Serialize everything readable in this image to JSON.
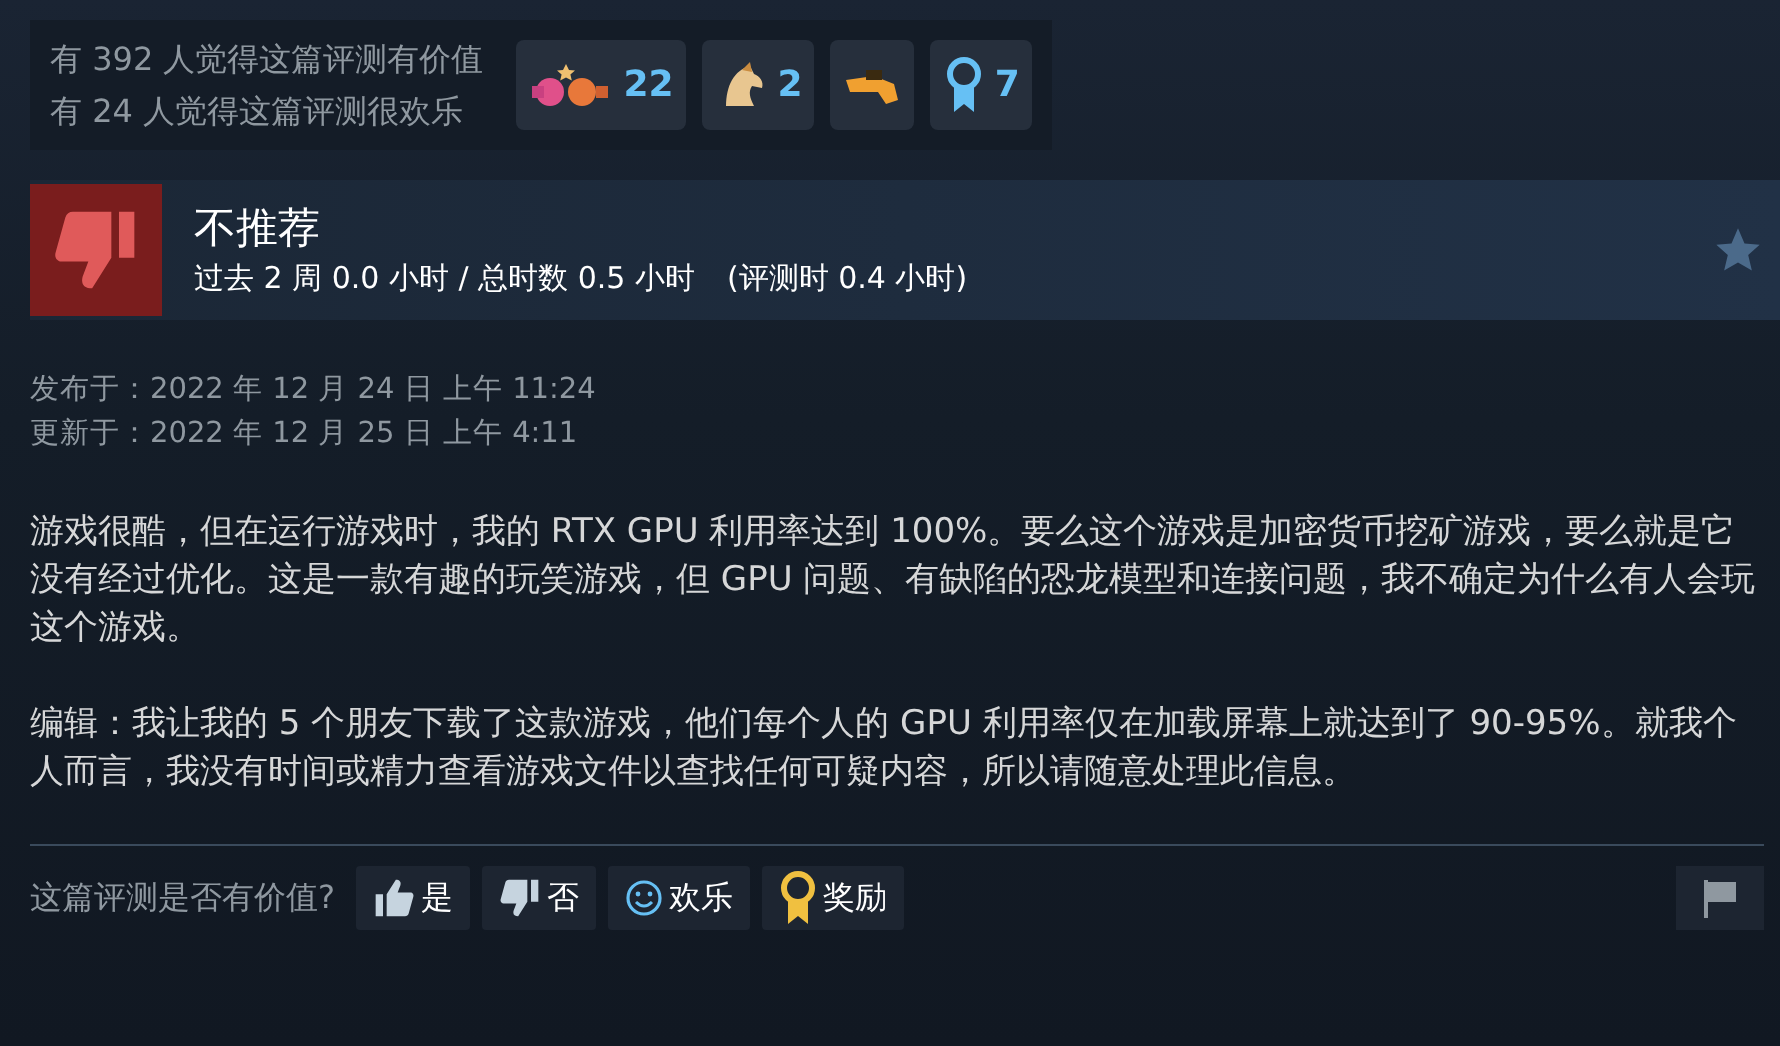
{
  "votes": {
    "helpful": "有 392 人觉得这篇评测有价值",
    "funny": "有 24 人觉得这篇评测很欢乐"
  },
  "awards": [
    {
      "kind": "boxing",
      "count": "22"
    },
    {
      "kind": "horse",
      "count": "2"
    },
    {
      "kind": "hand"
    },
    {
      "kind": "ribbon",
      "count": "7"
    }
  ],
  "review": {
    "recommended": false,
    "title": "不推荐",
    "hours": "过去 2 周 0.0 小时 / 总时数 0.5 小时",
    "hours_at_review": "(评测时 0.4 小时)"
  },
  "dates": [
    "发布于：2022 年 12 月 24 日 上午 11:24",
    "更新于：2022 年 12 月 25 日 上午 4:11"
  ],
  "paragraphs": [
    "游戏很酷，但在运行游戏时，我的 RTX GPU 利用率达到 100%。要么这个游戏是加密货币挖矿游戏，要么就是它没有经过优化。这是一款有趣的玩笑游戏，但 GPU 问题、有缺陷的恐龙模型和连接问题，我不确定为什么有人会玩这个游戏。",
    "编辑：我让我的 5 个朋友下载了这款游戏，他们每个人的 GPU 利用率仅在加载屏幕上就达到了 90-95%。就我个人而言，我没有时间或精力查看游戏文件以查找任何可疑内容，所以请随意处理此信息。"
  ],
  "footer": {
    "question": "这篇评测是否有价值?",
    "buttons": [
      {
        "kind": "yes",
        "label": "是"
      },
      {
        "kind": "no",
        "label": "否"
      },
      {
        "kind": "funny",
        "label": "欢乐"
      },
      {
        "kind": "award",
        "label": "奖励"
      }
    ]
  }
}
